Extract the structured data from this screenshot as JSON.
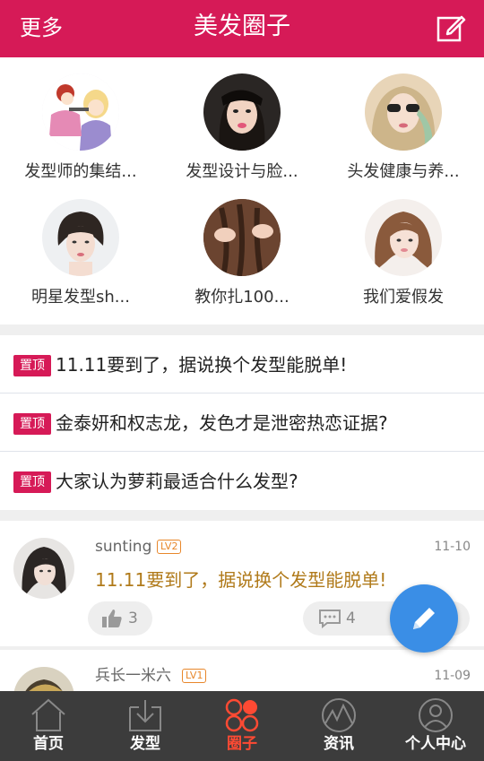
{
  "header": {
    "more_label": "更多",
    "title": "美发圈子",
    "edit_icon": "compose-icon",
    "bg_color": "#d61a57"
  },
  "groups": [
    {
      "label": "发型师的集结..."
    },
    {
      "label": "发型设计与脸..."
    },
    {
      "label": "头发健康与养..."
    },
    {
      "label": "明星发型sh..."
    },
    {
      "label": "教你扎100..."
    },
    {
      "label": "我们爱假发"
    }
  ],
  "pinned": {
    "badge": "置顶",
    "items": [
      {
        "text": "11.11要到了，据说换个发型能脱单!"
      },
      {
        "text": "金泰妍和权志龙，发色才是泄密热恋证据?"
      },
      {
        "text": "大家认为萝莉最适合什么发型?"
      }
    ]
  },
  "posts": [
    {
      "user": "sunting",
      "level": "LV2",
      "time": "11-10",
      "text": "11.11要到了，据说换个发型能脱单!",
      "likes": "3",
      "comments": "4"
    },
    {
      "user": "兵长一米六",
      "level": "LV1",
      "time": "11-09"
    }
  ],
  "tabs": [
    {
      "label": "首页",
      "icon": "home-icon"
    },
    {
      "label": "发型",
      "icon": "download-icon"
    },
    {
      "label": "圈子",
      "icon": "circles-icon"
    },
    {
      "label": "资讯",
      "icon": "news-wave-icon"
    },
    {
      "label": "个人中心",
      "icon": "profile-icon"
    }
  ],
  "colors": {
    "accent": "#d61a57",
    "fab": "#3a8ee6",
    "tab_active": "#ff4a33",
    "post_text": "#b07a1a"
  }
}
